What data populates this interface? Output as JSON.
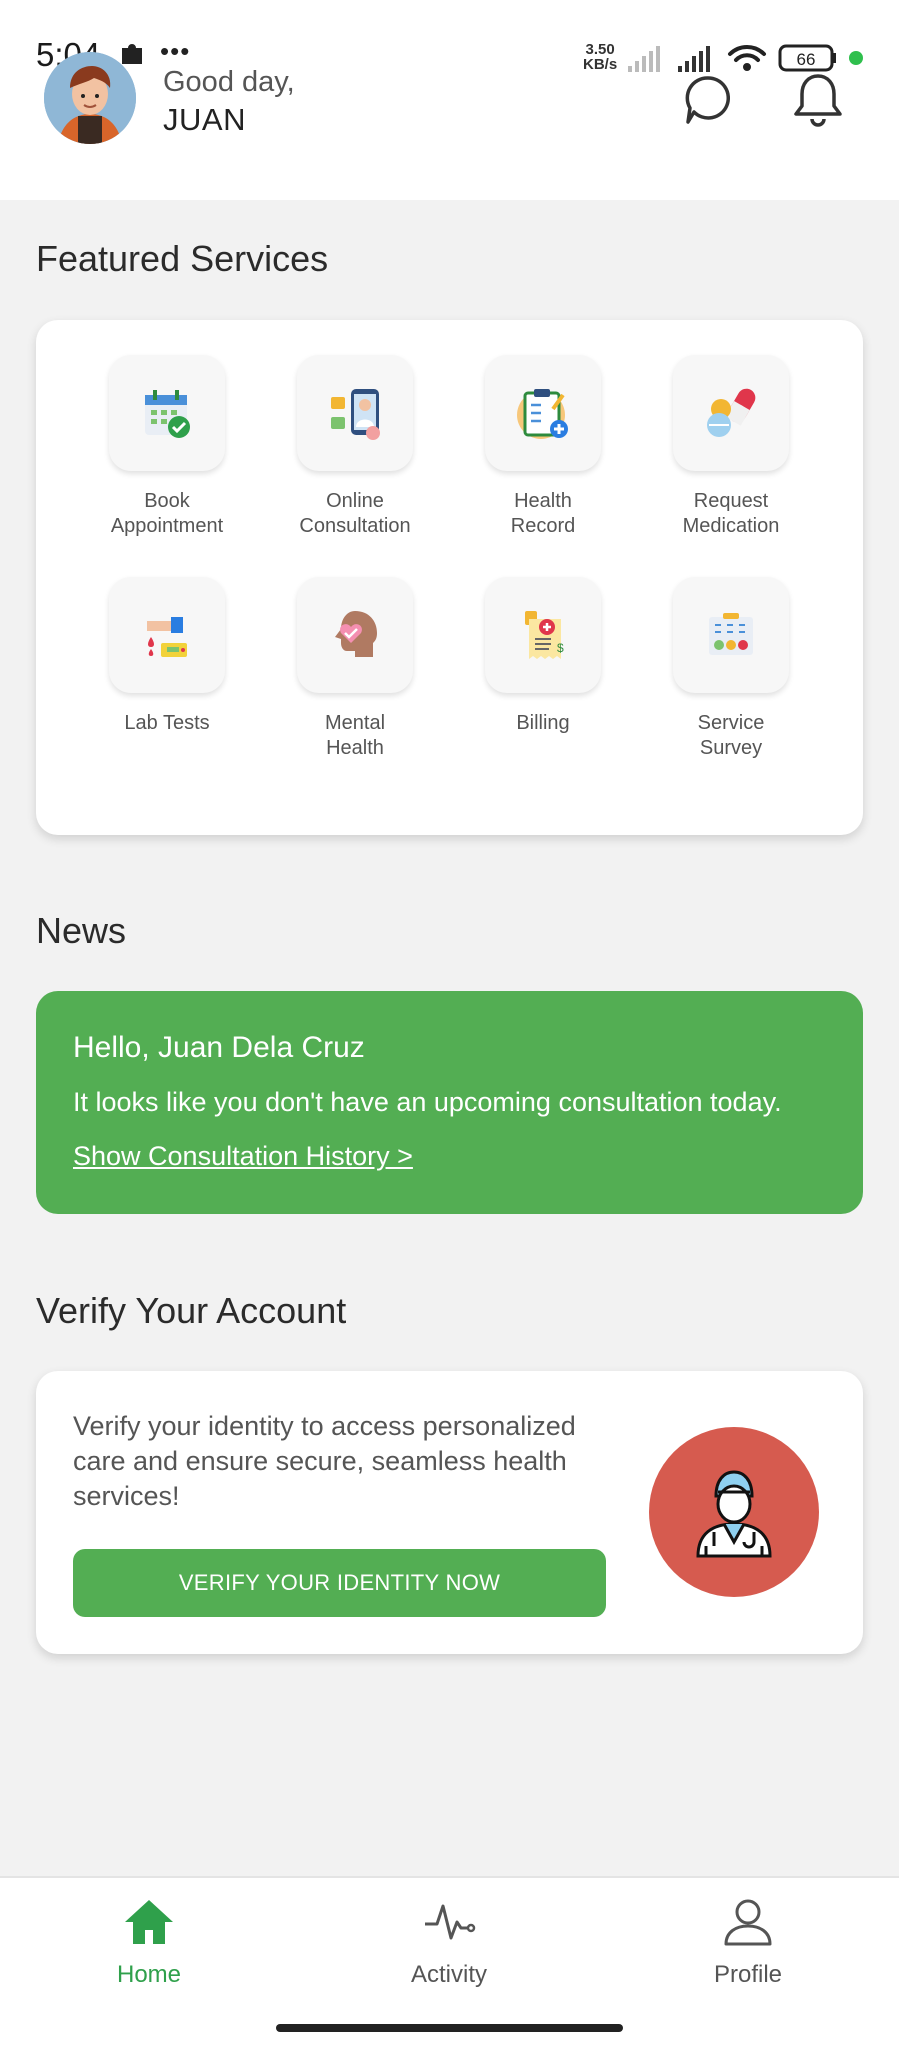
{
  "status_bar": {
    "time": "5:04",
    "more": "•••",
    "net_speed_value": "3.50",
    "net_speed_unit": "KB/s",
    "battery": "66",
    "icons": [
      "notification-puzzle-icon",
      "signal-icon",
      "signal-icon",
      "wifi-icon",
      "battery-icon",
      "status-dot-icon"
    ],
    "status_dot_color": "#2fbf4d"
  },
  "header": {
    "greeting": "Good day,",
    "user_name": "JUAN",
    "icons": [
      "avatar",
      "chat-icon",
      "bell-icon"
    ]
  },
  "featured": {
    "title": "Featured Services",
    "items": [
      {
        "label": "Book\nAppointment",
        "icon": "calendar-check-icon"
      },
      {
        "label": "Online\nConsultation",
        "icon": "video-doctor-icon"
      },
      {
        "label": "Health\nRecord",
        "icon": "clipboard-icon"
      },
      {
        "label": "Request\nMedication",
        "icon": "pills-icon"
      },
      {
        "label": "Lab Tests",
        "icon": "blood-test-icon"
      },
      {
        "label": "Mental\nHealth",
        "icon": "brain-heart-icon"
      },
      {
        "label": "Billing",
        "icon": "invoice-icon"
      },
      {
        "label": "Service\nSurvey",
        "icon": "survey-icon"
      }
    ]
  },
  "news": {
    "title": "News",
    "heading": "Hello, Juan Dela Cruz",
    "body": "It looks like you don't have an upcoming consultation today.",
    "link": "Show Consultation History >"
  },
  "verify": {
    "title": "Verify Your Account",
    "body": "Verify your identity to access personalized care and ensure secure, seamless health services!",
    "button": "VERIFY YOUR IDENTITY NOW",
    "icon": "doctor-icon"
  },
  "bottom_nav": {
    "items": [
      {
        "label": "Home",
        "icon": "home-icon",
        "active": true
      },
      {
        "label": "Activity",
        "icon": "pulse-icon",
        "active": false
      },
      {
        "label": "Profile",
        "icon": "person-icon",
        "active": false
      }
    ]
  },
  "colors": {
    "accent_green": "#53ae53",
    "active_nav": "#2fa04b",
    "verify_circle": "#d65b4f",
    "page_bg": "#f2f2f2"
  }
}
